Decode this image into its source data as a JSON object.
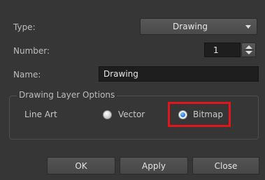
{
  "dialog": {
    "type_label": "Type:",
    "type_value": "Drawing",
    "number_label": "Number:",
    "number_value": "1",
    "name_label": "Name:",
    "name_value": "Drawing",
    "options_group": {
      "title": "Drawing Layer Options",
      "line_art_label": "Line Art",
      "options": [
        {
          "label": "Vector",
          "selected": false
        },
        {
          "label": "Bitmap",
          "selected": true
        }
      ]
    },
    "buttons": {
      "ok": "OK",
      "apply": "Apply",
      "close": "Close"
    }
  },
  "colors": {
    "background": "#363636",
    "field": "#1e1e1e",
    "highlight_border": "#e0161c",
    "radio_selected": "#1f6fd1"
  },
  "icons": {
    "dropdown": "chevron-down-icon",
    "spinner": "spin-up-down-icon"
  }
}
